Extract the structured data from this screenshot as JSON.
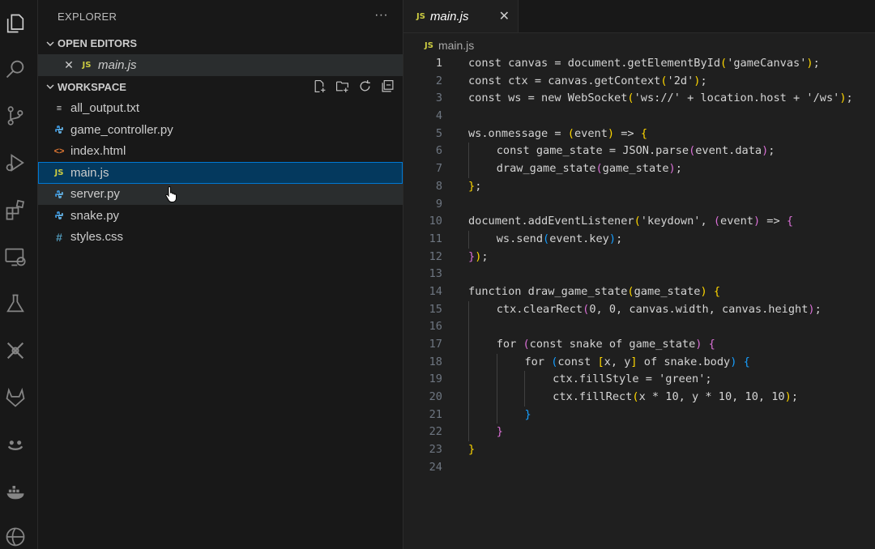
{
  "activity_bar": {
    "icons": [
      "explorer-icon",
      "search-icon",
      "source-control-icon",
      "run-debug-icon",
      "extensions-icon",
      "remote-explorer-icon",
      "testing-icon",
      "custom-extension-icon",
      "gitlab-icon",
      "copilot-icon",
      "docker-icon",
      "browser-icon"
    ]
  },
  "sidebar": {
    "title": "EXPLORER",
    "more": "···",
    "open_editors": {
      "label": "OPEN EDITORS",
      "items": [
        {
          "badge": "JS",
          "name": "main.js"
        }
      ]
    },
    "workspace": {
      "label": "WORKSPACE",
      "files": [
        {
          "name": "all_output.txt",
          "icon": "text-file-icon",
          "glyph": "≡",
          "color": "#cccccc"
        },
        {
          "name": "game_controller.py",
          "icon": "python-file-icon",
          "glyph": "",
          "color": "#3b8ccb"
        },
        {
          "name": "index.html",
          "icon": "html-file-icon",
          "glyph": "<>",
          "color": "#e37933"
        },
        {
          "name": "main.js",
          "icon": "js-file-icon",
          "glyph": "JS",
          "color": "#cbcb41"
        },
        {
          "name": "server.py",
          "icon": "python-file-icon",
          "glyph": "",
          "color": "#3b8ccb"
        },
        {
          "name": "snake.py",
          "icon": "python-file-icon",
          "glyph": "",
          "color": "#3b8ccb"
        },
        {
          "name": "styles.css",
          "icon": "css-file-icon",
          "glyph": "#",
          "color": "#519aba"
        }
      ]
    }
  },
  "editor": {
    "tab": {
      "badge": "JS",
      "label": "main.js",
      "close": "✕"
    },
    "breadcrumb": {
      "badge": "JS",
      "label": "main.js"
    },
    "lines": [
      {
        "n": "1",
        "indent": 0,
        "parts": [
          [
            "t",
            "const canvas = document.getElementById"
          ],
          [
            "b1",
            "("
          ],
          [
            "t",
            "'gameCanvas'"
          ],
          [
            "b1",
            ")"
          ],
          [
            "t",
            ";"
          ]
        ]
      },
      {
        "n": "2",
        "indent": 0,
        "parts": [
          [
            "t",
            "const ctx = canvas.getContext"
          ],
          [
            "b1",
            "("
          ],
          [
            "t",
            "'2d'"
          ],
          [
            "b1",
            ")"
          ],
          [
            "t",
            ";"
          ]
        ]
      },
      {
        "n": "3",
        "indent": 0,
        "parts": [
          [
            "t",
            "const ws = new WebSocket"
          ],
          [
            "b1",
            "("
          ],
          [
            "t",
            "'ws://' + location.host + '/ws'"
          ],
          [
            "b1",
            ")"
          ],
          [
            "t",
            ";"
          ]
        ]
      },
      {
        "n": "4",
        "indent": 0,
        "parts": []
      },
      {
        "n": "5",
        "indent": 0,
        "parts": [
          [
            "t",
            "ws.onmessage = "
          ],
          [
            "b1",
            "("
          ],
          [
            "t",
            "event"
          ],
          [
            "b1",
            ")"
          ],
          [
            "t",
            " => "
          ],
          [
            "b1",
            "{"
          ]
        ]
      },
      {
        "n": "6",
        "indent": 1,
        "parts": [
          [
            "t",
            "const game_state = JSON.parse"
          ],
          [
            "b2",
            "("
          ],
          [
            "t",
            "event.data"
          ],
          [
            "b2",
            ")"
          ],
          [
            "t",
            ";"
          ]
        ]
      },
      {
        "n": "7",
        "indent": 1,
        "parts": [
          [
            "t",
            "draw_game_state"
          ],
          [
            "b2",
            "("
          ],
          [
            "t",
            "game_state"
          ],
          [
            "b2",
            ")"
          ],
          [
            "t",
            ";"
          ]
        ]
      },
      {
        "n": "8",
        "indent": 0,
        "parts": [
          [
            "b1",
            "}"
          ],
          [
            "t",
            ";"
          ]
        ]
      },
      {
        "n": "9",
        "indent": 0,
        "parts": []
      },
      {
        "n": "10",
        "indent": 0,
        "parts": [
          [
            "t",
            "document.addEventListener"
          ],
          [
            "b1",
            "("
          ],
          [
            "t",
            "'keydown', "
          ],
          [
            "b2",
            "("
          ],
          [
            "t",
            "event"
          ],
          [
            "b2",
            ")"
          ],
          [
            "t",
            " => "
          ],
          [
            "b2",
            "{"
          ]
        ]
      },
      {
        "n": "11",
        "indent": 1,
        "parts": [
          [
            "t",
            "ws.send"
          ],
          [
            "b3",
            "("
          ],
          [
            "t",
            "event.key"
          ],
          [
            "b3",
            ")"
          ],
          [
            "t",
            ";"
          ]
        ]
      },
      {
        "n": "12",
        "indent": 0,
        "parts": [
          [
            "b2",
            "}"
          ],
          [
            "b1",
            ")"
          ],
          [
            "t",
            ";"
          ]
        ]
      },
      {
        "n": "13",
        "indent": 0,
        "parts": []
      },
      {
        "n": "14",
        "indent": 0,
        "parts": [
          [
            "t",
            "function draw_game_state"
          ],
          [
            "b1",
            "("
          ],
          [
            "t",
            "game_state"
          ],
          [
            "b1",
            ")"
          ],
          [
            "t",
            " "
          ],
          [
            "b1",
            "{"
          ]
        ]
      },
      {
        "n": "15",
        "indent": 1,
        "parts": [
          [
            "t",
            "ctx.clearRect"
          ],
          [
            "b2",
            "("
          ],
          [
            "t",
            "0, 0, canvas.width, canvas.height"
          ],
          [
            "b2",
            ")"
          ],
          [
            "t",
            ";"
          ]
        ]
      },
      {
        "n": "16",
        "indent": 1,
        "parts": []
      },
      {
        "n": "17",
        "indent": 1,
        "parts": [
          [
            "t",
            "for "
          ],
          [
            "b2",
            "("
          ],
          [
            "t",
            "const snake of game_state"
          ],
          [
            "b2",
            ")"
          ],
          [
            "t",
            " "
          ],
          [
            "b2",
            "{"
          ]
        ]
      },
      {
        "n": "18",
        "indent": 2,
        "parts": [
          [
            "t",
            "for "
          ],
          [
            "b3",
            "("
          ],
          [
            "t",
            "const "
          ],
          [
            "b1",
            "["
          ],
          [
            "t",
            "x, y"
          ],
          [
            "b1",
            "]"
          ],
          [
            "t",
            " of snake.body"
          ],
          [
            "b3",
            ")"
          ],
          [
            "t",
            " "
          ],
          [
            "b3",
            "{"
          ]
        ]
      },
      {
        "n": "19",
        "indent": 3,
        "parts": [
          [
            "t",
            "ctx.fillStyle = 'green';"
          ]
        ]
      },
      {
        "n": "20",
        "indent": 3,
        "parts": [
          [
            "t",
            "ctx.fillRect"
          ],
          [
            "b1",
            "("
          ],
          [
            "t",
            "x * 10, y * 10, 10, 10"
          ],
          [
            "b1",
            ")"
          ],
          [
            "t",
            ";"
          ]
        ]
      },
      {
        "n": "21",
        "indent": 2,
        "parts": [
          [
            "b3",
            "}"
          ]
        ]
      },
      {
        "n": "22",
        "indent": 1,
        "parts": [
          [
            "b2",
            "}"
          ]
        ]
      },
      {
        "n": "23",
        "indent": 0,
        "parts": [
          [
            "b1",
            "}"
          ]
        ]
      },
      {
        "n": "24",
        "indent": 0,
        "parts": []
      }
    ]
  },
  "colors": {
    "accent": "#0078d4",
    "js": "#cbcb41",
    "python": "#3b8ccb",
    "html": "#e37933",
    "css": "#519aba"
  }
}
